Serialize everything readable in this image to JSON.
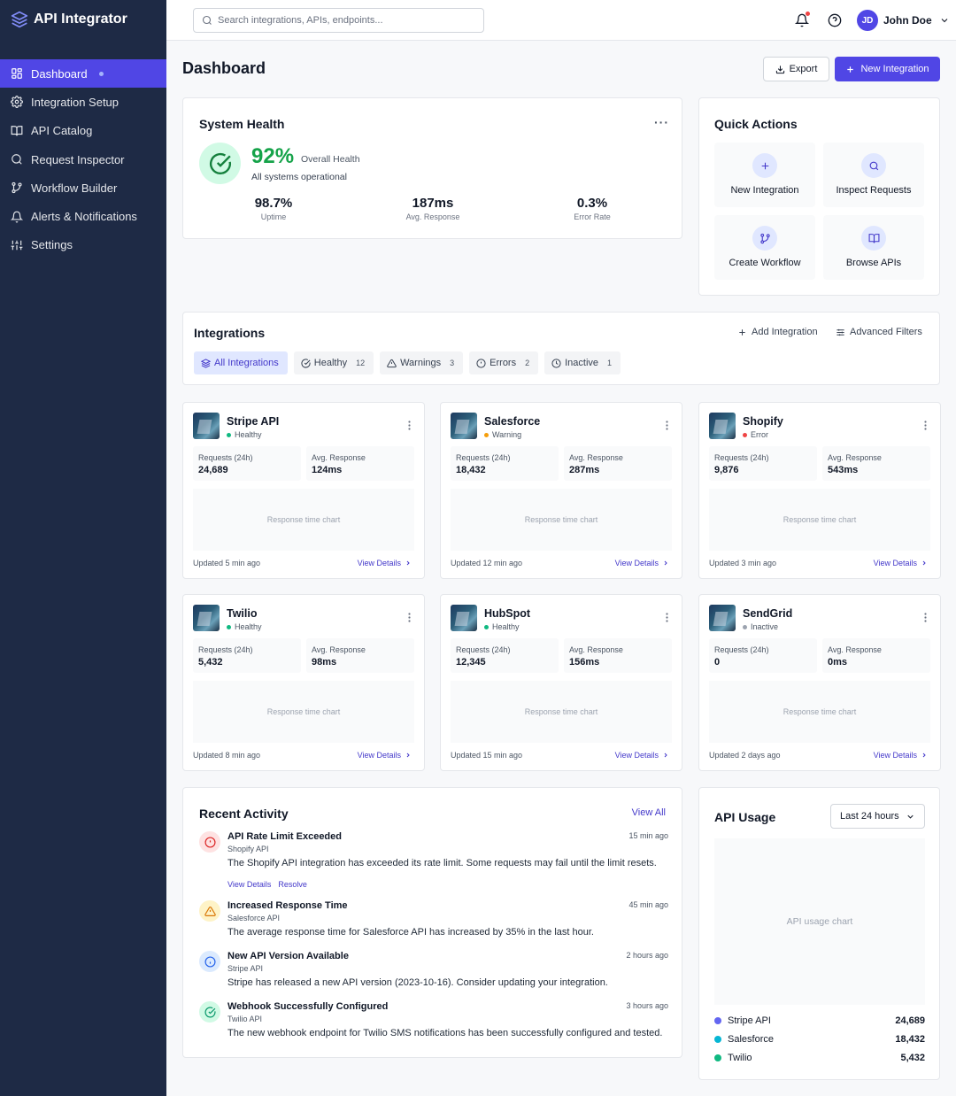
{
  "app": {
    "title": "API Integrator"
  },
  "sidebar": {
    "items": [
      {
        "label": "Dashboard",
        "icon": "grid-icon"
      },
      {
        "label": "Integration Setup",
        "icon": "gear-icon"
      },
      {
        "label": "API Catalog",
        "icon": "book-icon"
      },
      {
        "label": "Request Inspector",
        "icon": "search-icon"
      },
      {
        "label": "Workflow Builder",
        "icon": "git-branch-icon"
      },
      {
        "label": "Alerts & Notifications",
        "icon": "bell-icon"
      },
      {
        "label": "Settings",
        "icon": "sliders-icon"
      }
    ]
  },
  "header": {
    "search_placeholder": "Search integrations, APIs, endpoints...",
    "user": {
      "initials": "JD",
      "name": "John Doe"
    }
  },
  "page": {
    "title": "Dashboard",
    "export_label": "Export",
    "new_integration_label": "New Integration"
  },
  "health": {
    "title": "System Health",
    "percent": "92%",
    "label": "Overall Health",
    "subtitle": "All systems operational",
    "metrics": [
      {
        "value": "98.7%",
        "label": "Uptime"
      },
      {
        "value": "187ms",
        "label": "Avg. Response"
      },
      {
        "value": "0.3%",
        "label": "Error Rate"
      }
    ]
  },
  "quick_actions": {
    "title": "Quick Actions",
    "items": [
      {
        "label": "New Integration",
        "icon": "plus-icon"
      },
      {
        "label": "Inspect Requests",
        "icon": "search-icon"
      },
      {
        "label": "Create Workflow",
        "icon": "git-branch-icon"
      },
      {
        "label": "Browse APIs",
        "icon": "book-open-icon"
      }
    ]
  },
  "integrations": {
    "title": "Integrations",
    "add_label": "Add Integration",
    "filters_label": "Advanced Filters",
    "filters": [
      {
        "label": "All Integrations",
        "count": ""
      },
      {
        "label": "Healthy",
        "count": "12"
      },
      {
        "label": "Warnings",
        "count": "3"
      },
      {
        "label": "Errors",
        "count": "2"
      },
      {
        "label": "Inactive",
        "count": "1"
      }
    ],
    "requests_label": "Requests (24h)",
    "response_label": "Avg. Response",
    "chart_placeholder": "Response time chart",
    "view_details": "View Details",
    "cards": [
      {
        "name": "Stripe API",
        "status": "Healthy",
        "status_color": "#10b981",
        "requests": "24,689",
        "response": "124ms",
        "updated": "Updated 5 min ago"
      },
      {
        "name": "Salesforce",
        "status": "Warning",
        "status_color": "#f59e0b",
        "requests": "18,432",
        "response": "287ms",
        "updated": "Updated 12 min ago"
      },
      {
        "name": "Shopify",
        "status": "Error",
        "status_color": "#ef4444",
        "requests": "9,876",
        "response": "543ms",
        "updated": "Updated 3 min ago"
      },
      {
        "name": "Twilio",
        "status": "Healthy",
        "status_color": "#10b981",
        "requests": "5,432",
        "response": "98ms",
        "updated": "Updated 8 min ago"
      },
      {
        "name": "HubSpot",
        "status": "Healthy",
        "status_color": "#10b981",
        "requests": "12,345",
        "response": "156ms",
        "updated": "Updated 15 min ago"
      },
      {
        "name": "SendGrid",
        "status": "Inactive",
        "status_color": "#9ca3af",
        "requests": "0",
        "response": "0ms",
        "updated": "Updated 2 days ago"
      }
    ]
  },
  "activity": {
    "title": "Recent Activity",
    "view_all": "View All",
    "items": [
      {
        "title": "API Rate Limit Exceeded",
        "source": "Shopify API",
        "time": "15 min ago",
        "desc": "The Shopify API integration has exceeded its rate limit. Some requests may fail until the limit resets.",
        "links": [
          "View Details",
          "Resolve"
        ],
        "kind": "error"
      },
      {
        "title": "Increased Response Time",
        "source": "Salesforce API",
        "time": "45 min ago",
        "desc": "The average response time for Salesforce API has increased by 35% in the last hour.",
        "kind": "warning"
      },
      {
        "title": "New API Version Available",
        "source": "Stripe API",
        "time": "2 hours ago",
        "desc": "Stripe has released a new API version (2023-10-16). Consider updating your integration.",
        "kind": "info"
      },
      {
        "title": "Webhook Successfully Configured",
        "source": "Twilio API",
        "time": "3 hours ago",
        "desc": "The new webhook endpoint for Twilio SMS notifications has been successfully configured and tested.",
        "kind": "success"
      }
    ]
  },
  "usage": {
    "title": "API Usage",
    "range": "Last 24 hours",
    "chart_placeholder": "API usage chart",
    "legend": [
      {
        "name": "Stripe API",
        "value": "24,689",
        "color": "#6366f1"
      },
      {
        "name": "Salesforce",
        "value": "18,432",
        "color": "#06b6d4"
      },
      {
        "name": "Twilio",
        "value": "5,432",
        "color": "#10b981"
      }
    ]
  },
  "colors": {
    "accent": "#5046e5",
    "sidebar": "#1e2a45",
    "healthy": "#10b981",
    "warning": "#f59e0b",
    "error": "#ef4444"
  }
}
